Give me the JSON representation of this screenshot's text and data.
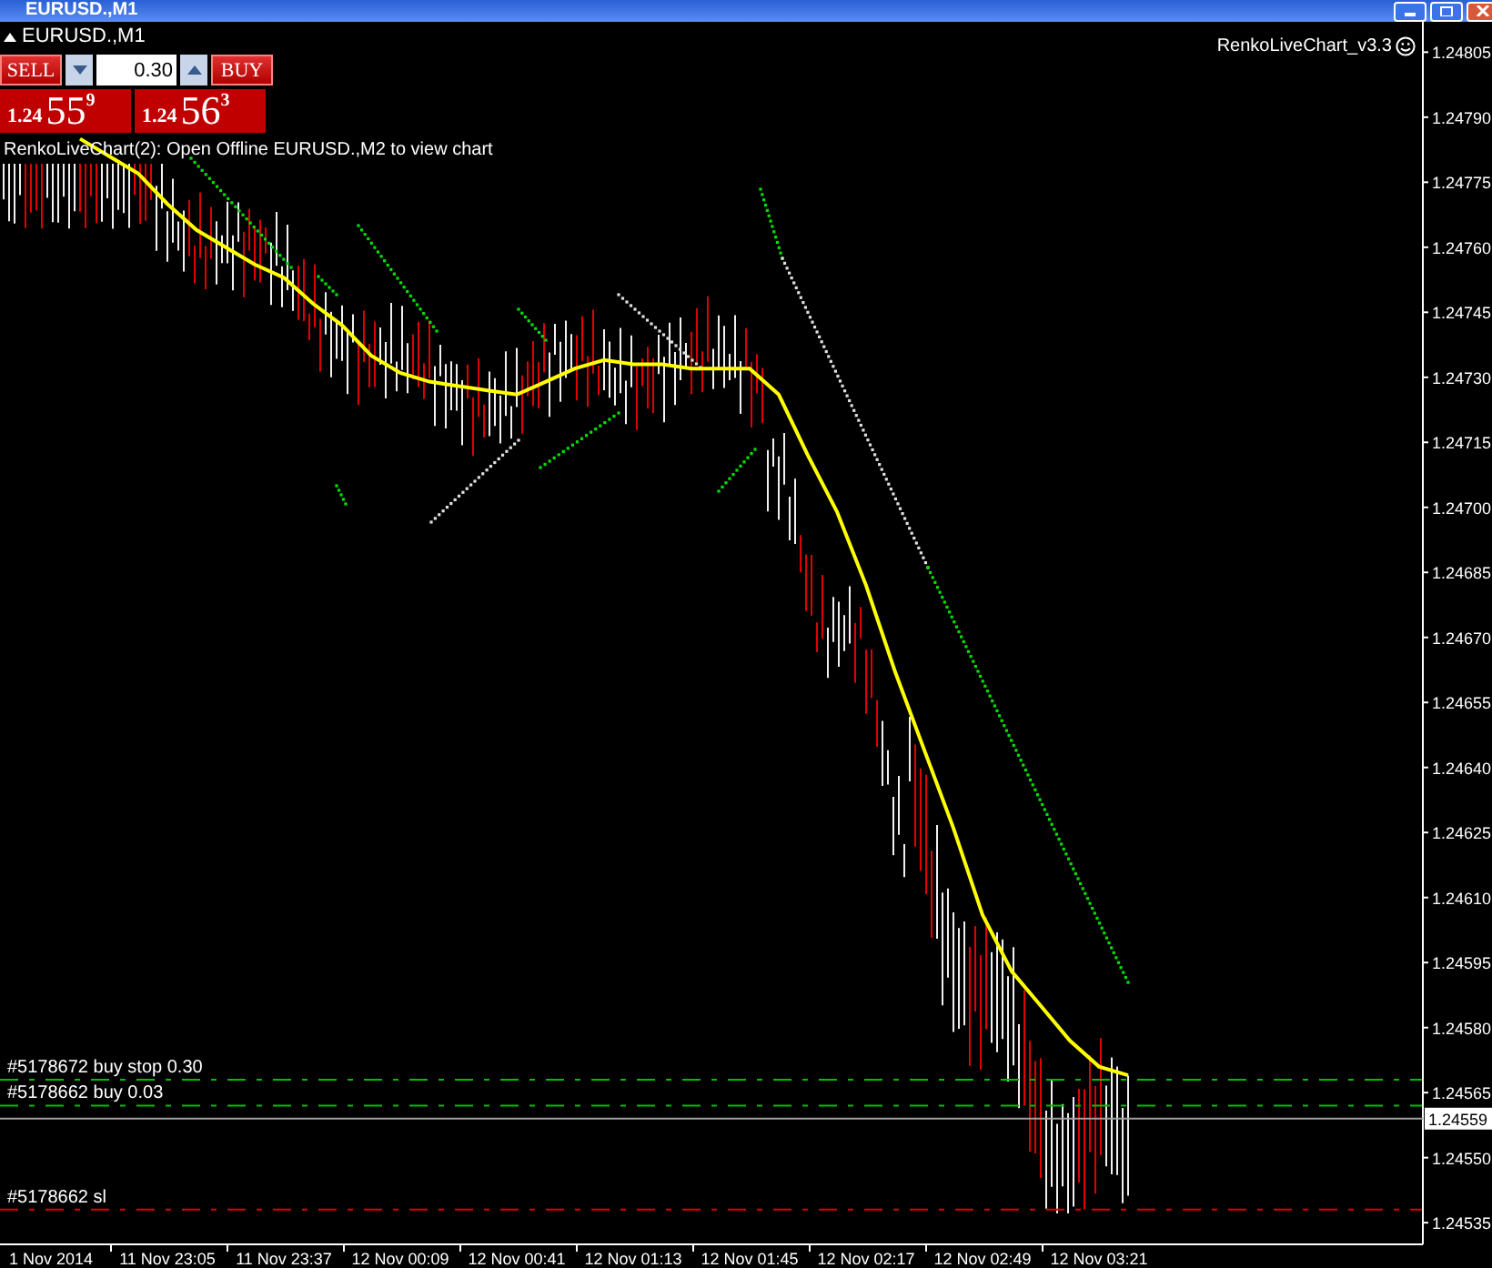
{
  "window": {
    "title": "EURUSD.,M1"
  },
  "symbol_label": "EURUSD.,M1",
  "trade_panel": {
    "sell": {
      "label": "SELL",
      "price_prefix": "1.24",
      "price_big": "55",
      "price_sup": "9"
    },
    "lot": {
      "value": "0.30"
    },
    "buy": {
      "label": "BUY",
      "price_prefix": "1.24",
      "price_big": "56",
      "price_sup": "3"
    }
  },
  "indicator_message": "RenkoLiveChart(2): Open Offline EURUSD.,M2 to view chart",
  "indicator_name": "RenkoLiveChart_v3.3",
  "bid_price": {
    "label": "1.24559"
  },
  "chart_data": {
    "type": "line",
    "categories": [
      "1 Nov 2014",
      null,
      null,
      null,
      "11 Nov 23:05",
      null,
      null,
      null,
      "11 Nov 23:37",
      null,
      null,
      null,
      "12 Nov 00:09",
      null,
      null,
      null,
      "12 Nov 00:41",
      null,
      null,
      null,
      "12 Nov 01:13",
      null,
      null,
      null,
      "12 Nov 01:45",
      null,
      null,
      null,
      "12 Nov 02:17",
      null,
      null,
      null,
      "12 Nov 02:49",
      null,
      null,
      null,
      "12 Nov 03:21",
      null,
      null,
      null
    ],
    "ylim": [
      1.2453,
      1.24812
    ],
    "yticks": [
      {
        "value": 1.24805,
        "label": "1.24805"
      },
      {
        "value": 1.2479,
        "label": "1.24790"
      },
      {
        "value": 1.24775,
        "label": "1.24775"
      },
      {
        "value": 1.2476,
        "label": "1.24760"
      },
      {
        "value": 1.24745,
        "label": "1.24745"
      },
      {
        "value": 1.2473,
        "label": "1.24730"
      },
      {
        "value": 1.24715,
        "label": "1.24715"
      },
      {
        "value": 1.247,
        "label": "1.24700"
      },
      {
        "value": 1.24685,
        "label": "1.24685"
      },
      {
        "value": 1.2467,
        "label": "1.24670"
      },
      {
        "value": 1.24655,
        "label": "1.24655"
      },
      {
        "value": 1.2464,
        "label": "1.24640"
      },
      {
        "value": 1.24625,
        "label": "1.24625"
      },
      {
        "value": 1.2461,
        "label": "1.24610"
      },
      {
        "value": 1.24595,
        "label": "1.24595"
      },
      {
        "value": 1.2458,
        "label": "1.24580"
      },
      {
        "value": 1.24565,
        "label": "1.24565"
      },
      {
        "value": 1.2455,
        "label": "1.24550"
      },
      {
        "value": 1.24535,
        "label": "1.24535"
      }
    ],
    "series": [
      {
        "color": "#ffff00",
        "values": [
          null,
          1.24785,
          1.24781,
          1.24777,
          1.2477,
          1.24764,
          1.2476,
          1.24756,
          1.24753,
          1.24747,
          1.24742,
          1.24735,
          1.24731,
          1.24729,
          1.24728,
          1.24727,
          1.24726,
          1.24729,
          1.24732,
          1.24734,
          1.24733,
          1.24733,
          1.24732,
          1.24732,
          1.24732,
          1.24726,
          1.24712,
          1.24699,
          1.24682,
          1.24662,
          1.24644,
          1.24626,
          1.24606,
          1.24593,
          1.24585,
          1.24577,
          1.24571,
          1.24569,
          null,
          null
        ]
      }
    ],
    "ref_lines": [
      {
        "axis": "y",
        "value": 1.24568,
        "label": "#5178672 buy stop 0.30",
        "color": "#00c000"
      },
      {
        "axis": "y",
        "value": 1.24562,
        "label": "#5178662 buy 0.03",
        "color": "#00c000"
      },
      {
        "axis": "y",
        "value": 1.24538,
        "label": "#5178662 sl",
        "color": "#e00000"
      }
    ]
  }
}
